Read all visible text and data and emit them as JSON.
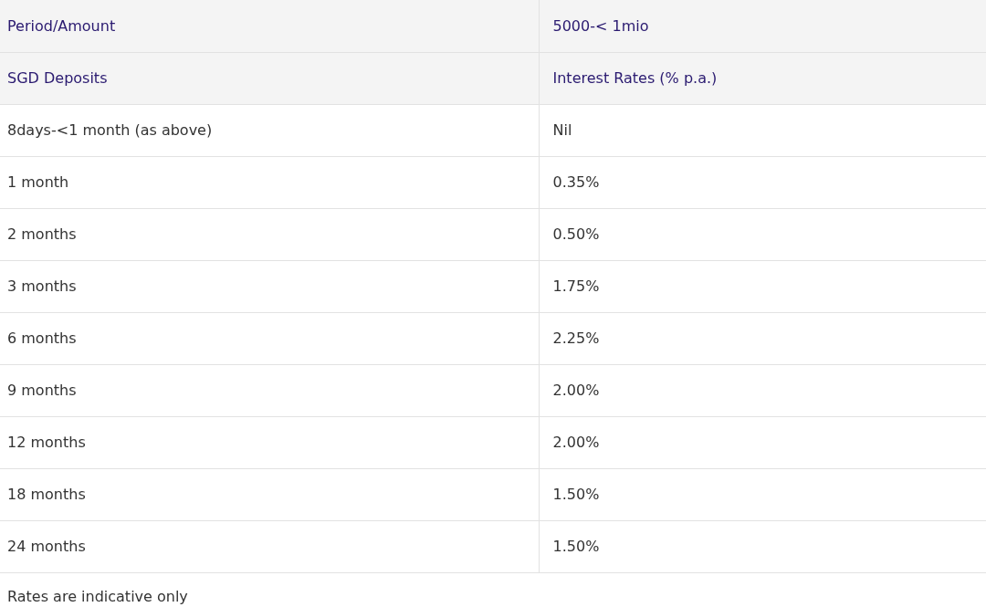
{
  "table": {
    "header_rows": [
      [
        "Period/Amount",
        "5000-< 1mio"
      ],
      [
        "SGD Deposits",
        "Interest Rates (% p.a.)"
      ]
    ],
    "rows": [
      [
        "8days-<1 month (as above)",
        "Nil"
      ],
      [
        "1 month",
        "0.35%"
      ],
      [
        "2 months",
        "0.50%"
      ],
      [
        "3 months",
        "1.75%"
      ],
      [
        "6 months",
        "2.25%"
      ],
      [
        "9 months",
        "2.00%"
      ],
      [
        "12 months",
        "2.00%"
      ],
      [
        "18 months",
        "1.50%"
      ],
      [
        "24 months",
        "1.50%"
      ]
    ]
  },
  "footnote": "Rates are indicative only"
}
